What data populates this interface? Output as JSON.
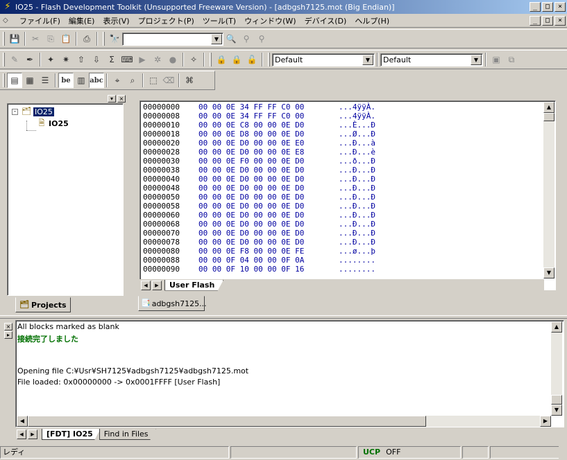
{
  "window": {
    "title": "IO25 - Flash Development Toolkit  (Unsupported Freeware Version) - [adbgsh7125.mot  (Big Endian)]",
    "controls": [
      "_",
      "□",
      "×"
    ]
  },
  "menubar": {
    "items": [
      "ファイル(F)",
      "編集(E)",
      "表示(V)",
      "プロジェクト(P)",
      "ツール(T)",
      "ウィンドウ(W)",
      "デバイス(D)",
      "ヘルプ(H)"
    ],
    "mdi_controls": [
      "_",
      "□",
      "×"
    ]
  },
  "toolbar": {
    "find_combo_value": "",
    "combo1_value": "Default",
    "combo2_value": "Default",
    "text_buttons": [
      "be",
      "abc"
    ]
  },
  "workspace": {
    "tree": {
      "root_label": "IO25",
      "child_label": "IO25",
      "expander": "-"
    },
    "tab_label": "Projects"
  },
  "editor": {
    "rows": [
      {
        "addr": "00000000",
        "hex": "00 00 0E 34 FF FF C0 00",
        "ascii": "...4ÿÿÀ."
      },
      {
        "addr": "00000008",
        "hex": "00 00 0E 34 FF FF C0 00",
        "ascii": "...4ÿÿÀ."
      },
      {
        "addr": "00000010",
        "hex": "00 00 0E C8 00 00 0E D0",
        "ascii": "...È...Ð"
      },
      {
        "addr": "00000018",
        "hex": "00 00 0E D8 00 00 0E D0",
        "ascii": "...Ø...Ð"
      },
      {
        "addr": "00000020",
        "hex": "00 00 0E D0 00 00 0E E0",
        "ascii": "...Ð...à"
      },
      {
        "addr": "00000028",
        "hex": "00 00 0E D0 00 00 0E E8",
        "ascii": "...Ð...è"
      },
      {
        "addr": "00000030",
        "hex": "00 00 0E F0 00 00 0E D0",
        "ascii": "...ð...Ð"
      },
      {
        "addr": "00000038",
        "hex": "00 00 0E D0 00 00 0E D0",
        "ascii": "...Ð...Ð"
      },
      {
        "addr": "00000040",
        "hex": "00 00 0E D0 00 00 0E D0",
        "ascii": "...Ð...Ð"
      },
      {
        "addr": "00000048",
        "hex": "00 00 0E D0 00 00 0E D0",
        "ascii": "...Ð...Ð"
      },
      {
        "addr": "00000050",
        "hex": "00 00 0E D0 00 00 0E D0",
        "ascii": "...Ð...Ð"
      },
      {
        "addr": "00000058",
        "hex": "00 00 0E D0 00 00 0E D0",
        "ascii": "...Ð...Ð"
      },
      {
        "addr": "00000060",
        "hex": "00 00 0E D0 00 00 0E D0",
        "ascii": "...Ð...Ð"
      },
      {
        "addr": "00000068",
        "hex": "00 00 0E D0 00 00 0E D0",
        "ascii": "...Ð...Ð"
      },
      {
        "addr": "00000070",
        "hex": "00 00 0E D0 00 00 0E D0",
        "ascii": "...Ð...Ð"
      },
      {
        "addr": "00000078",
        "hex": "00 00 0E D0 00 00 0E D0",
        "ascii": "...Ð...Ð"
      },
      {
        "addr": "00000080",
        "hex": "00 00 0E F8 00 00 0E FE",
        "ascii": "...ø...þ"
      },
      {
        "addr": "00000088",
        "hex": "00 00 0F 04 00 00 0F 0A",
        "ascii": "........"
      },
      {
        "addr": "00000090",
        "hex": "00 00 0F 10 00 00 0F 16",
        "ascii": "........"
      }
    ],
    "sheet_tab": "User Flash",
    "doc_tab": "adbgsh7125..."
  },
  "output": {
    "lines": [
      "All blocks marked as blank",
      "接続完了しました",
      "",
      "",
      "Opening file C:¥Usr¥SH7125¥adbgsh7125¥adbgsh7125.mot",
      "   File loaded: 0x00000000 -> 0x0001FFFF  [User Flash]"
    ],
    "tabs": [
      "[FDT] IO25",
      "Find in Files"
    ]
  },
  "statusbar": {
    "ready": "レディ",
    "ucp_label": "UCP",
    "ucp_value": "OFF"
  },
  "colors": {
    "title_start": "#0a246a",
    "title_end": "#a6caf0",
    "hex_text": "#0000a0",
    "success_text": "#007000",
    "face": "#d4d0c8"
  }
}
